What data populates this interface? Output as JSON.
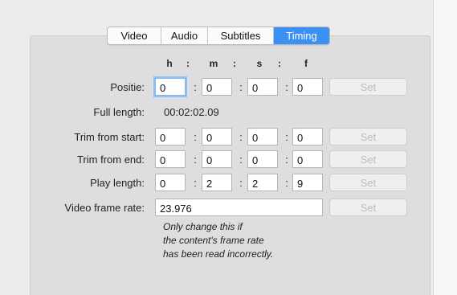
{
  "tabs": [
    {
      "label": "Video",
      "active": false
    },
    {
      "label": "Audio",
      "active": false
    },
    {
      "label": "Subtitles",
      "active": false
    },
    {
      "label": "Timing",
      "active": true
    }
  ],
  "headers": {
    "h": "h",
    "m": "m",
    "s": "s",
    "f": "f",
    "sep": ":"
  },
  "position": {
    "label": "Positie:",
    "h": "0",
    "m": "0",
    "s": "0",
    "f": "0",
    "button": "Set"
  },
  "full_length": {
    "label": "Full length:",
    "value": "00:02:02.09"
  },
  "trim_start": {
    "label": "Trim from start:",
    "h": "0",
    "m": "0",
    "s": "0",
    "f": "0",
    "button": "Set"
  },
  "trim_end": {
    "label": "Trim from end:",
    "h": "0",
    "m": "0",
    "s": "0",
    "f": "0",
    "button": "Set"
  },
  "play_length": {
    "label": "Play length:",
    "h": "0",
    "m": "2",
    "s": "2",
    "f": "9",
    "button": "Set"
  },
  "frame_rate": {
    "label": "Video frame rate:",
    "value": "23.976",
    "button": "Set"
  },
  "note": {
    "line1": "Only change this if",
    "line2": "the content's frame rate",
    "line3": "has been read incorrectly."
  },
  "colors": {
    "accent": "#3b90f3",
    "panel": "#dedede",
    "window": "#ececec"
  }
}
